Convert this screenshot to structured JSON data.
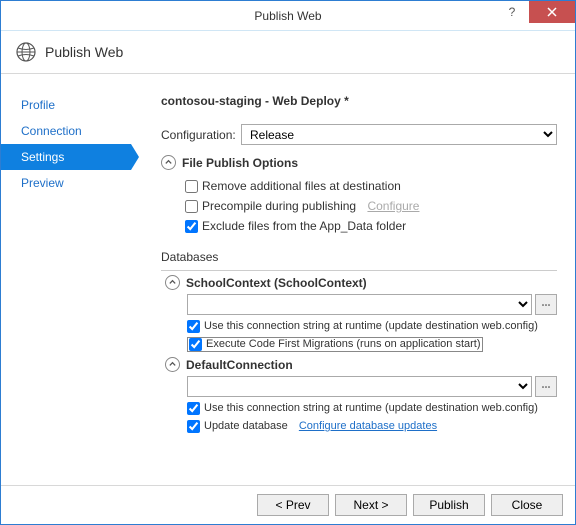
{
  "window": {
    "title": "Publish Web"
  },
  "header": {
    "title": "Publish Web"
  },
  "nav": {
    "items": [
      "Profile",
      "Connection",
      "Settings",
      "Preview"
    ],
    "active_index": 2
  },
  "profile_title": "contosou-staging - Web Deploy *",
  "config": {
    "label": "Configuration:",
    "value": "Release"
  },
  "file_publish": {
    "title": "File Publish Options",
    "remove_additional": {
      "label": "Remove additional files at destination",
      "checked": false
    },
    "precompile": {
      "label": "Precompile during publishing",
      "checked": false,
      "link": "Configure"
    },
    "exclude_appdata": {
      "label": "Exclude files from the App_Data folder",
      "checked": true
    }
  },
  "databases": {
    "title": "Databases",
    "items": [
      {
        "name": "SchoolContext (SchoolContext)",
        "conn_value": "",
        "use_conn": {
          "label": "Use this connection string at runtime (update destination web.config)",
          "checked": true
        },
        "migrate": {
          "label": "Execute Code First Migrations (runs on application start)",
          "checked": true,
          "boxed": true
        }
      },
      {
        "name": "DefaultConnection",
        "conn_value": "",
        "use_conn": {
          "label": "Use this connection string at runtime (update destination web.config)",
          "checked": true
        },
        "update_db": {
          "label": "Update database",
          "checked": true,
          "link": "Configure database updates"
        }
      }
    ]
  },
  "footer": {
    "prev": "< Prev",
    "next": "Next >",
    "publish": "Publish",
    "close": "Close"
  }
}
